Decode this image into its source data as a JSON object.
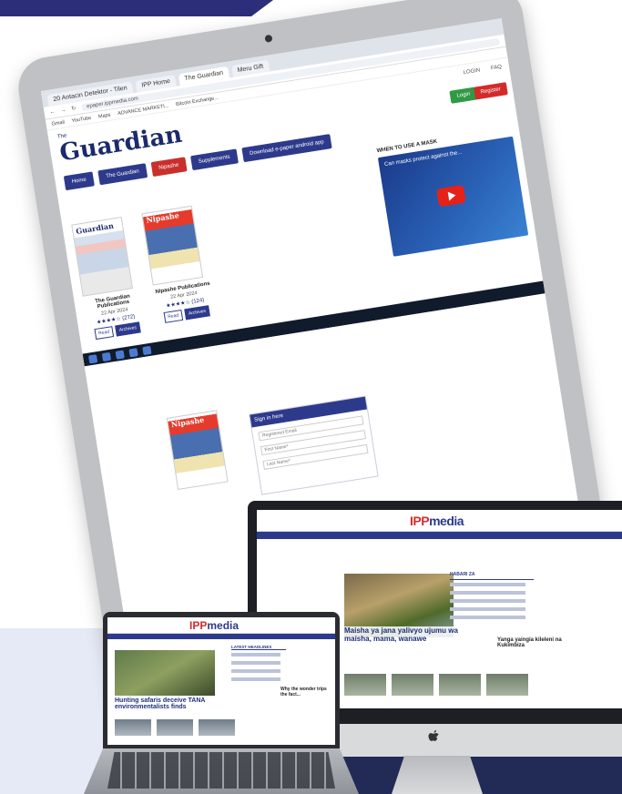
{
  "browser": {
    "tabs": [
      "20 Antacin Detektor - Tilen",
      "IPP Home",
      "The Guardian",
      "Meru Gift"
    ],
    "address": "epaper.ippmedia.com",
    "bookmarks": [
      "Gmail",
      "YouTube",
      "Maps",
      "ADVANCE MARKETI...",
      "Bitcoin Exchange..."
    ]
  },
  "guardian_site": {
    "logo": "Guardian",
    "logo_small": "The",
    "header_links": [
      "LOGIN",
      "FAQ"
    ],
    "login_button": "Login",
    "register_button": "Register",
    "nav": [
      "Home",
      "The Guardian",
      "Nipashe",
      "Supplements",
      "Download e-paper android app"
    ],
    "publications": [
      {
        "mast": "Guardian",
        "title": "The Guardian Publications",
        "date": "22 Apr 2024",
        "stars": "★★★★☆ (272)",
        "buttons": [
          "Read",
          "Archives"
        ]
      },
      {
        "mast": "Nipashe",
        "title": "Nipashe Publications",
        "date": "22 Apr 2024",
        "stars": "★★★★☆ (124)",
        "buttons": [
          "Read",
          "Archives"
        ]
      }
    ],
    "video_heading": "WHEN TO USE A MASK",
    "video_caption": "Can masks protect against the..."
  },
  "second_page": {
    "panel_title": "Sign in here",
    "fields": [
      "Registered Email",
      "First Name*",
      "Last Name*"
    ]
  },
  "ipp_site": {
    "logo_prefix": "IPP",
    "logo_suffix": "media",
    "hero_title": "Maisha ya jana yalivyo ujumu wa maisha, mama, wanawe",
    "side_heading": "HABARI ZA",
    "feature_title": "Yanga yaingia kileleni na Kukimbiza"
  },
  "laptop_site": {
    "logo_prefix": "IPP",
    "logo_suffix": "media",
    "hero_title": "Hunting safaris deceive TANA environmentalists finds",
    "side_heading": "LATEST HEADLINES",
    "feature_title": "Why the wonder trips the fact..."
  }
}
